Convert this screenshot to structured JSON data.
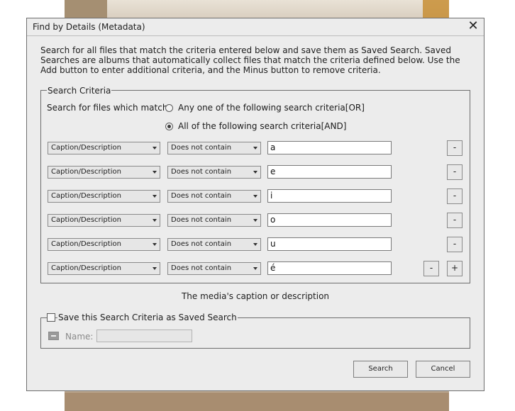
{
  "window": {
    "title": "Find by Details (Metadata)",
    "close_icon": "close-icon"
  },
  "intro_text": "Search for all files that match the criteria entered below and save them as Saved Search. Saved Searches are albums that automatically collect files that match the criteria defined below. Use the Add button to enter additional criteria, and the Minus button to remove criteria.",
  "criteria": {
    "legend": "Search Criteria",
    "match_label": "Search for files which match:",
    "options": [
      {
        "label": "Any one of the following search criteria[OR]",
        "selected": false
      },
      {
        "label": "All of the following search criteria[AND]",
        "selected": true
      }
    ],
    "rows": [
      {
        "field": "Caption/Description",
        "operator": "Does not contain",
        "value": "a",
        "remove_label": "-"
      },
      {
        "field": "Caption/Description",
        "operator": "Does not contain",
        "value": "e",
        "remove_label": "-"
      },
      {
        "field": "Caption/Description",
        "operator": "Does not contain",
        "value": "i",
        "remove_label": "-"
      },
      {
        "field": "Caption/Description",
        "operator": "Does not contain",
        "value": "o",
        "remove_label": "-"
      },
      {
        "field": "Caption/Description",
        "operator": "Does not contain",
        "value": "u",
        "remove_label": "-"
      },
      {
        "field": "Caption/Description",
        "operator": "Does not contain",
        "value": "é",
        "remove_label": "-",
        "add_label": "+"
      }
    ],
    "field_description": "The media's caption or description"
  },
  "save": {
    "checkbox_label": "Save this Search Criteria as Saved Search",
    "checked": false,
    "name_label": "Name:",
    "name_value": ""
  },
  "buttons": {
    "search": "Search",
    "cancel": "Cancel"
  }
}
